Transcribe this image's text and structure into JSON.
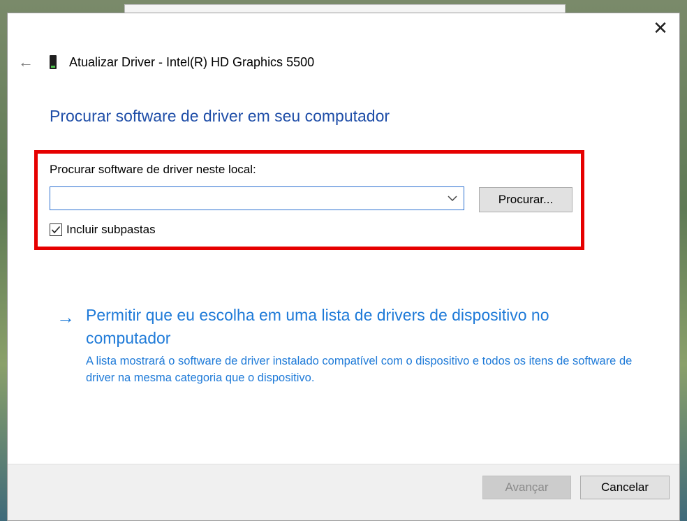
{
  "window": {
    "title": "Atualizar Driver -  Intel(R) HD Graphics 5500",
    "close_glyph": "✕",
    "back_glyph": "←"
  },
  "page": {
    "heading": "Procurar software de driver em seu computador",
    "location_label": "Procurar software de driver neste local:",
    "location_value": "",
    "browse_label": "Procurar...",
    "include_subfolders_label": "Incluir subpastas",
    "include_subfolders_checked": true,
    "link": {
      "arrow_glyph": "→",
      "title": "Permitir que eu escolha em uma lista de drivers de dispositivo no computador",
      "description": "A lista mostrará o software de driver instalado compatível com o dispositivo e todos os itens de software de driver na mesma categoria que o dispositivo."
    }
  },
  "footer": {
    "next_label": "Avançar",
    "cancel_label": "Cancelar"
  },
  "colors": {
    "heading": "#1f4ea8",
    "link": "#1e7ad8",
    "highlight": "#e60000"
  },
  "icons": {
    "back": "back-arrow-icon",
    "device": "display-adapter-icon",
    "close": "close-icon",
    "dropdown": "chevron-down-icon",
    "check": "checkmark-icon",
    "link": "right-arrow-icon"
  }
}
